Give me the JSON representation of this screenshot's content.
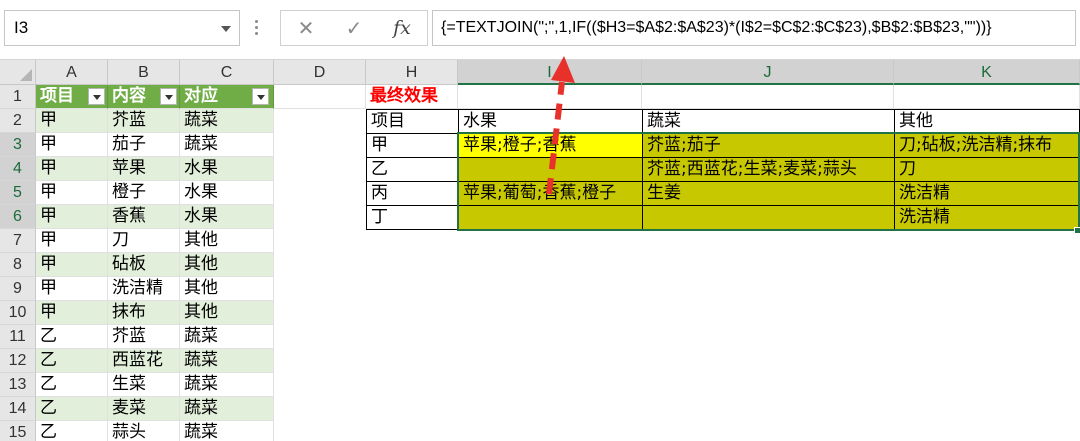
{
  "name_box": {
    "value": "I3"
  },
  "formula_bar": {
    "cancel_glyph": "✕",
    "enter_glyph": "✓",
    "fx_label": "fx",
    "formula": "{=TEXTJOIN(\";\",1,IF(($H3=$A$2:$A$23)*(I$2=$C$2:$C$23),$B$2:$B$23,\"\"))}"
  },
  "column_headers": [
    "A",
    "B",
    "C",
    "D",
    "H",
    "I",
    "J",
    "K"
  ],
  "row_headers": [
    "1",
    "2",
    "3",
    "4",
    "5",
    "6",
    "7",
    "8",
    "9",
    "10",
    "11",
    "12",
    "13",
    "14",
    "15"
  ],
  "source_table": {
    "headers": [
      "项目",
      "内容",
      "对应"
    ],
    "rows": [
      [
        "甲",
        "芥蓝",
        "蔬菜"
      ],
      [
        "甲",
        "茄子",
        "蔬菜"
      ],
      [
        "甲",
        "苹果",
        "水果"
      ],
      [
        "甲",
        "橙子",
        "水果"
      ],
      [
        "甲",
        "香蕉",
        "水果"
      ],
      [
        "甲",
        "刀",
        "其他"
      ],
      [
        "甲",
        "砧板",
        "其他"
      ],
      [
        "甲",
        "洗洁精",
        "其他"
      ],
      [
        "甲",
        "抹布",
        "其他"
      ],
      [
        "乙",
        "芥蓝",
        "蔬菜"
      ],
      [
        "乙",
        "西蓝花",
        "蔬菜"
      ],
      [
        "乙",
        "生菜",
        "蔬菜"
      ],
      [
        "乙",
        "麦菜",
        "蔬菜"
      ],
      [
        "乙",
        "蒜头",
        "蔬菜"
      ]
    ]
  },
  "result_table": {
    "title": "最终效果",
    "headers": [
      "项目",
      "水果",
      "蔬菜",
      "其他"
    ],
    "rows": [
      [
        "甲",
        "苹果;橙子;香蕉",
        "芥蓝;茄子",
        "刀;砧板;洗洁精;抹布"
      ],
      [
        "乙",
        "",
        "芥蓝;西蓝花;生菜;麦菜;蒜头",
        "刀"
      ],
      [
        "丙",
        "苹果;葡萄;香蕉;橙子",
        "生姜",
        "洗洁精"
      ],
      [
        "丁",
        "",
        "",
        "洗洁精"
      ]
    ]
  },
  "colors": {
    "table_header": "#70ad47",
    "table_band": "#e2efda",
    "result_fill": "#c8c800",
    "active_cell_fill": "#ffff00",
    "title_red": "#ff0000",
    "arrow_red": "#e8312a",
    "selection_green": "#217346"
  },
  "annotation": {
    "type": "dashed-arrow",
    "points_to": "formula_bar"
  }
}
